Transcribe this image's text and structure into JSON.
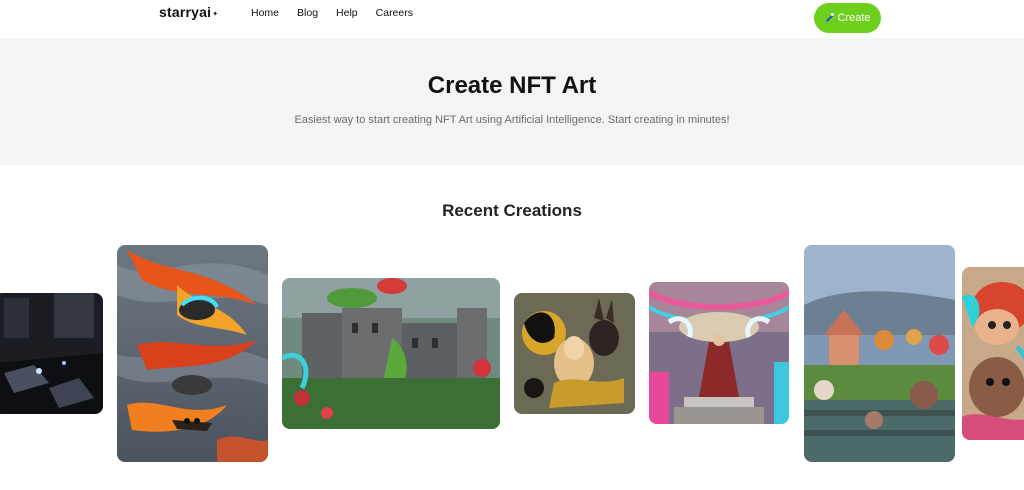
{
  "nav": {
    "logo": "starryai",
    "logo_mark": "✦",
    "links": [
      "Home",
      "Blog",
      "Help",
      "Careers"
    ],
    "create_label": "Create"
  },
  "hero": {
    "title": "Create NFT Art",
    "subtitle": "Easiest way to start creating NFT Art using Artificial Intelligence. Start creating in minutes!"
  },
  "recent": {
    "title": "Recent Creations"
  },
  "colors": {
    "accent": "#6fcf1d",
    "hero_bg": "#f4f4f4"
  }
}
